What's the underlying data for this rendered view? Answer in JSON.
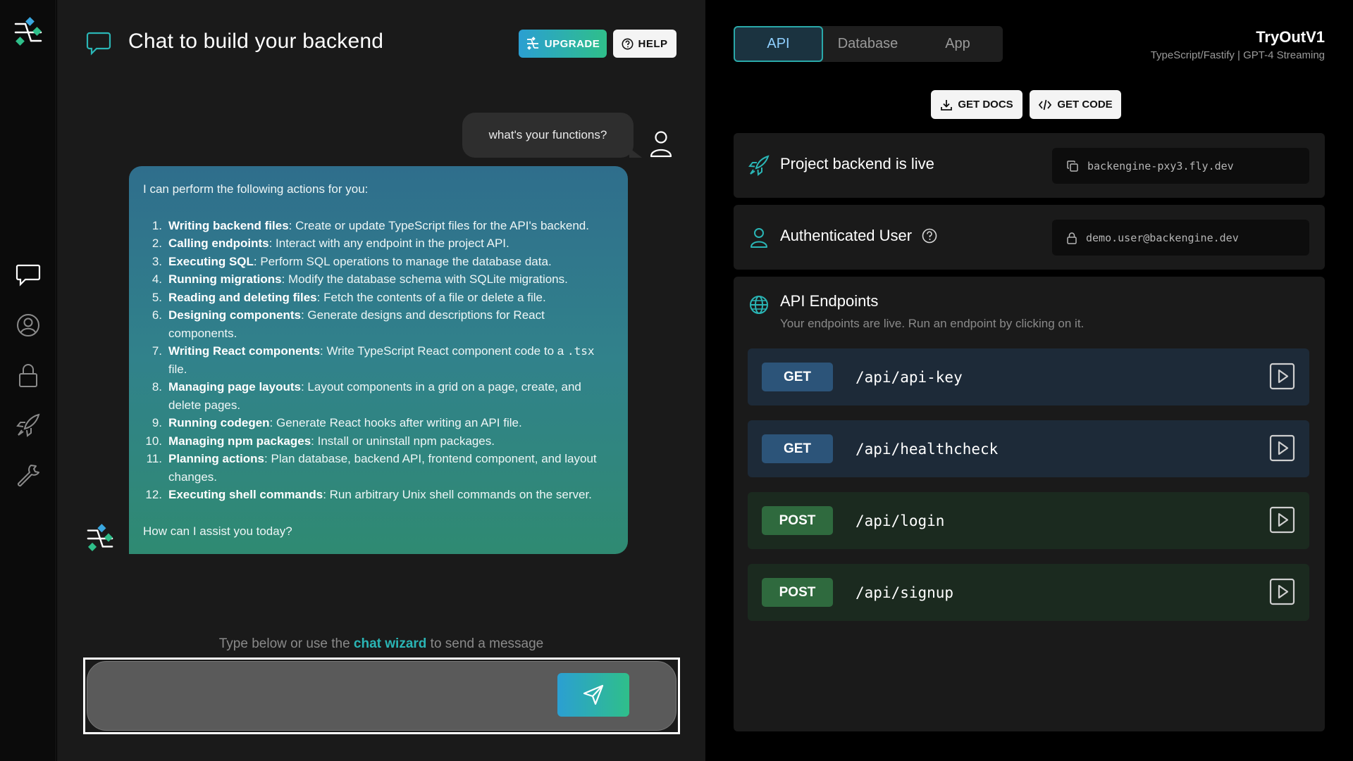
{
  "chat": {
    "title": "Chat to build your backend",
    "upgrade_label": "UPGRADE",
    "help_label": "HELP",
    "user_message": "what's your functions?",
    "assistant_intro": "I can perform the following actions for you:",
    "assistant_items": [
      {
        "num": "1.",
        "title": "Writing backend files",
        "desc": ": Create or update TypeScript files for the API's backend."
      },
      {
        "num": "2.",
        "title": "Calling endpoints",
        "desc": ": Interact with any endpoint in the project API."
      },
      {
        "num": "3.",
        "title": "Executing SQL",
        "desc": ": Perform SQL operations to manage the database data."
      },
      {
        "num": "4.",
        "title": "Running migrations",
        "desc": ": Modify the database schema with SQLite migrations."
      },
      {
        "num": "5.",
        "title": "Reading and deleting files",
        "desc": ": Fetch the contents of a file or delete a file."
      },
      {
        "num": "6.",
        "title": "Designing components",
        "desc": ": Generate designs and descriptions for React components."
      },
      {
        "num": "7.",
        "title": "Writing React components",
        "desc": ": Write TypeScript React component code to a",
        "code": ".tsx",
        "desc_after": "file."
      },
      {
        "num": "8.",
        "title": "Managing page layouts",
        "desc": ": Layout components in a grid on a page, create, and delete pages."
      },
      {
        "num": "9.",
        "title": "Running codegen",
        "desc": ": Generate React hooks after writing an API file."
      },
      {
        "num": "10.",
        "title": "Managing npm packages",
        "desc": ": Install or uninstall npm packages."
      },
      {
        "num": "11.",
        "title": "Planning actions",
        "desc": ": Plan database, backend API, frontend component, and layout changes."
      },
      {
        "num": "12.",
        "title": "Executing shell commands",
        "desc": ": Run arbitrary Unix shell commands on the server."
      }
    ],
    "assistant_outro": "How can I assist you today?",
    "hint_before": "Type below or use the ",
    "hint_link": "chat wizard",
    "hint_after": " to send a message",
    "input_value": ""
  },
  "right": {
    "tabs": [
      "API",
      "Database",
      "App"
    ],
    "active_tab": "API",
    "brand_name": "TryOutV1",
    "brand_sub": "TypeScript/Fastify | GPT-4 Streaming",
    "get_docs_label": "GET DOCS",
    "get_code_label": "GET CODE",
    "live_label": "Project backend is live",
    "live_url": "backengine-pxy3.fly.dev",
    "auth_label": "Authenticated User",
    "auth_user": "demo.user@backengine.dev",
    "endpoints_title": "API Endpoints",
    "endpoints_sub": "Your endpoints are live. Run an endpoint by clicking on it.",
    "endpoints": [
      {
        "method": "GET",
        "path": "/api/api-key"
      },
      {
        "method": "GET",
        "path": "/api/healthcheck"
      },
      {
        "method": "POST",
        "path": "/api/login"
      },
      {
        "method": "POST",
        "path": "/api/signup"
      }
    ]
  },
  "colors": {
    "accent_teal": "#2ab5b5",
    "get_method": "#2c5479",
    "post_method": "#2f6a3e"
  },
  "icons": {
    "rail": [
      "logo-icon",
      "chat-icon",
      "user-icon",
      "lock-icon",
      "rocket-icon",
      "wrench-icon"
    ]
  }
}
